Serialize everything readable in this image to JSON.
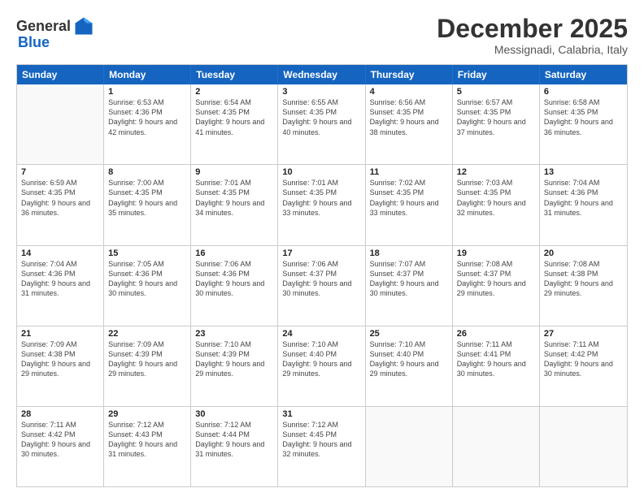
{
  "header": {
    "logo_general": "General",
    "logo_blue": "Blue",
    "month_title": "December 2025",
    "subtitle": "Messignadi, Calabria, Italy"
  },
  "weekdays": [
    "Sunday",
    "Monday",
    "Tuesday",
    "Wednesday",
    "Thursday",
    "Friday",
    "Saturday"
  ],
  "rows": [
    [
      {
        "day": "",
        "sunrise": "",
        "sunset": "",
        "daylight": "",
        "empty": true
      },
      {
        "day": "1",
        "sunrise": "Sunrise: 6:53 AM",
        "sunset": "Sunset: 4:36 PM",
        "daylight": "Daylight: 9 hours and 42 minutes."
      },
      {
        "day": "2",
        "sunrise": "Sunrise: 6:54 AM",
        "sunset": "Sunset: 4:35 PM",
        "daylight": "Daylight: 9 hours and 41 minutes."
      },
      {
        "day": "3",
        "sunrise": "Sunrise: 6:55 AM",
        "sunset": "Sunset: 4:35 PM",
        "daylight": "Daylight: 9 hours and 40 minutes."
      },
      {
        "day": "4",
        "sunrise": "Sunrise: 6:56 AM",
        "sunset": "Sunset: 4:35 PM",
        "daylight": "Daylight: 9 hours and 38 minutes."
      },
      {
        "day": "5",
        "sunrise": "Sunrise: 6:57 AM",
        "sunset": "Sunset: 4:35 PM",
        "daylight": "Daylight: 9 hours and 37 minutes."
      },
      {
        "day": "6",
        "sunrise": "Sunrise: 6:58 AM",
        "sunset": "Sunset: 4:35 PM",
        "daylight": "Daylight: 9 hours and 36 minutes."
      }
    ],
    [
      {
        "day": "7",
        "sunrise": "Sunrise: 6:59 AM",
        "sunset": "Sunset: 4:35 PM",
        "daylight": "Daylight: 9 hours and 36 minutes."
      },
      {
        "day": "8",
        "sunrise": "Sunrise: 7:00 AM",
        "sunset": "Sunset: 4:35 PM",
        "daylight": "Daylight: 9 hours and 35 minutes."
      },
      {
        "day": "9",
        "sunrise": "Sunrise: 7:01 AM",
        "sunset": "Sunset: 4:35 PM",
        "daylight": "Daylight: 9 hours and 34 minutes."
      },
      {
        "day": "10",
        "sunrise": "Sunrise: 7:01 AM",
        "sunset": "Sunset: 4:35 PM",
        "daylight": "Daylight: 9 hours and 33 minutes."
      },
      {
        "day": "11",
        "sunrise": "Sunrise: 7:02 AM",
        "sunset": "Sunset: 4:35 PM",
        "daylight": "Daylight: 9 hours and 33 minutes."
      },
      {
        "day": "12",
        "sunrise": "Sunrise: 7:03 AM",
        "sunset": "Sunset: 4:35 PM",
        "daylight": "Daylight: 9 hours and 32 minutes."
      },
      {
        "day": "13",
        "sunrise": "Sunrise: 7:04 AM",
        "sunset": "Sunset: 4:36 PM",
        "daylight": "Daylight: 9 hours and 31 minutes."
      }
    ],
    [
      {
        "day": "14",
        "sunrise": "Sunrise: 7:04 AM",
        "sunset": "Sunset: 4:36 PM",
        "daylight": "Daylight: 9 hours and 31 minutes."
      },
      {
        "day": "15",
        "sunrise": "Sunrise: 7:05 AM",
        "sunset": "Sunset: 4:36 PM",
        "daylight": "Daylight: 9 hours and 30 minutes."
      },
      {
        "day": "16",
        "sunrise": "Sunrise: 7:06 AM",
        "sunset": "Sunset: 4:36 PM",
        "daylight": "Daylight: 9 hours and 30 minutes."
      },
      {
        "day": "17",
        "sunrise": "Sunrise: 7:06 AM",
        "sunset": "Sunset: 4:37 PM",
        "daylight": "Daylight: 9 hours and 30 minutes."
      },
      {
        "day": "18",
        "sunrise": "Sunrise: 7:07 AM",
        "sunset": "Sunset: 4:37 PM",
        "daylight": "Daylight: 9 hours and 30 minutes."
      },
      {
        "day": "19",
        "sunrise": "Sunrise: 7:08 AM",
        "sunset": "Sunset: 4:37 PM",
        "daylight": "Daylight: 9 hours and 29 minutes."
      },
      {
        "day": "20",
        "sunrise": "Sunrise: 7:08 AM",
        "sunset": "Sunset: 4:38 PM",
        "daylight": "Daylight: 9 hours and 29 minutes."
      }
    ],
    [
      {
        "day": "21",
        "sunrise": "Sunrise: 7:09 AM",
        "sunset": "Sunset: 4:38 PM",
        "daylight": "Daylight: 9 hours and 29 minutes."
      },
      {
        "day": "22",
        "sunrise": "Sunrise: 7:09 AM",
        "sunset": "Sunset: 4:39 PM",
        "daylight": "Daylight: 9 hours and 29 minutes."
      },
      {
        "day": "23",
        "sunrise": "Sunrise: 7:10 AM",
        "sunset": "Sunset: 4:39 PM",
        "daylight": "Daylight: 9 hours and 29 minutes."
      },
      {
        "day": "24",
        "sunrise": "Sunrise: 7:10 AM",
        "sunset": "Sunset: 4:40 PM",
        "daylight": "Daylight: 9 hours and 29 minutes."
      },
      {
        "day": "25",
        "sunrise": "Sunrise: 7:10 AM",
        "sunset": "Sunset: 4:40 PM",
        "daylight": "Daylight: 9 hours and 29 minutes."
      },
      {
        "day": "26",
        "sunrise": "Sunrise: 7:11 AM",
        "sunset": "Sunset: 4:41 PM",
        "daylight": "Daylight: 9 hours and 30 minutes."
      },
      {
        "day": "27",
        "sunrise": "Sunrise: 7:11 AM",
        "sunset": "Sunset: 4:42 PM",
        "daylight": "Daylight: 9 hours and 30 minutes."
      }
    ],
    [
      {
        "day": "28",
        "sunrise": "Sunrise: 7:11 AM",
        "sunset": "Sunset: 4:42 PM",
        "daylight": "Daylight: 9 hours and 30 minutes."
      },
      {
        "day": "29",
        "sunrise": "Sunrise: 7:12 AM",
        "sunset": "Sunset: 4:43 PM",
        "daylight": "Daylight: 9 hours and 31 minutes."
      },
      {
        "day": "30",
        "sunrise": "Sunrise: 7:12 AM",
        "sunset": "Sunset: 4:44 PM",
        "daylight": "Daylight: 9 hours and 31 minutes."
      },
      {
        "day": "31",
        "sunrise": "Sunrise: 7:12 AM",
        "sunset": "Sunset: 4:45 PM",
        "daylight": "Daylight: 9 hours and 32 minutes."
      },
      {
        "day": "",
        "sunrise": "",
        "sunset": "",
        "daylight": "",
        "empty": true
      },
      {
        "day": "",
        "sunrise": "",
        "sunset": "",
        "daylight": "",
        "empty": true
      },
      {
        "day": "",
        "sunrise": "",
        "sunset": "",
        "daylight": "",
        "empty": true
      }
    ]
  ]
}
